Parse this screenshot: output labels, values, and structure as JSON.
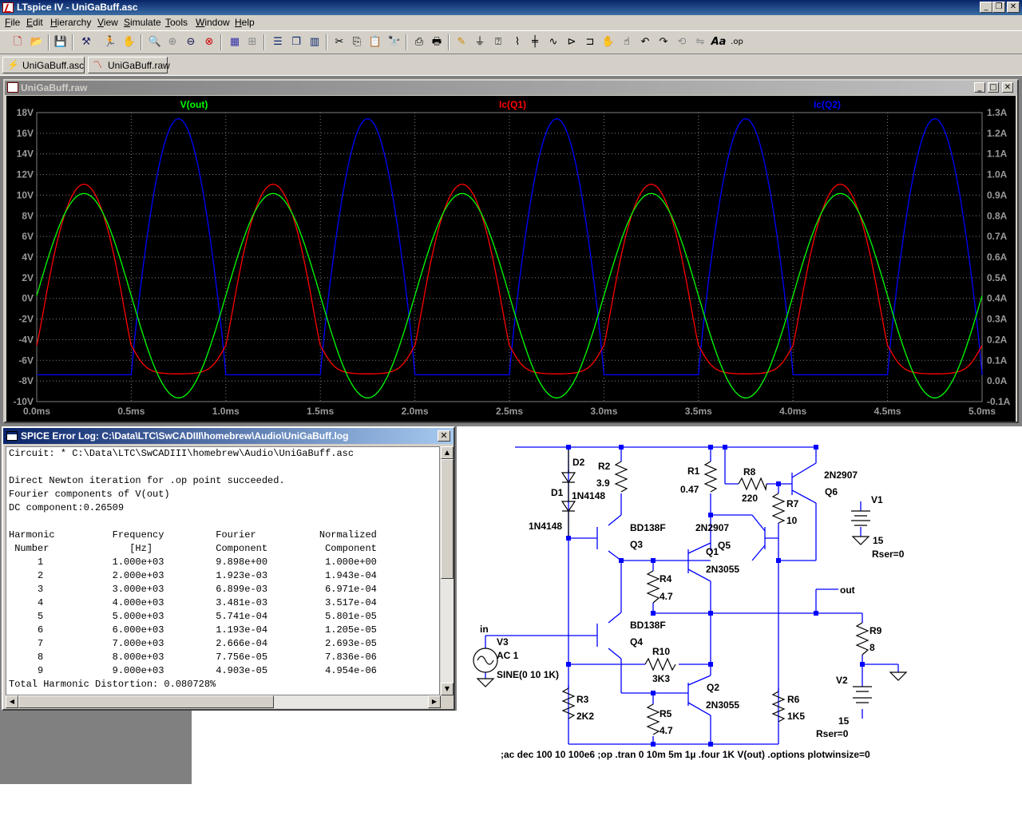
{
  "window": {
    "title": "LTspice IV - UniGaBuff.asc",
    "controls": {
      "minimize": "_",
      "restore": "❐",
      "close": "✕"
    }
  },
  "menu": [
    "File",
    "Edit",
    "Hierarchy",
    "View",
    "Simulate",
    "Tools",
    "Window",
    "Help"
  ],
  "toolbar_icons": [
    "new-schematic-icon",
    "open-icon",
    "save-icon",
    "control-panel-icon",
    "run-icon",
    "halt-icon",
    "zoom-in-icon",
    "zoom-pan-icon",
    "zoom-out-icon",
    "zoom-fit-icon",
    "autorange-icon",
    "grid-icon",
    "tile-horizontal-icon",
    "cascade-icon",
    "tile-vertical-icon",
    "cut-icon",
    "copy-icon",
    "paste-icon",
    "find-icon",
    "print-setup-icon",
    "print-icon",
    "wire-icon",
    "ground-icon",
    "label-net-icon",
    "resistor-icon",
    "capacitor-icon",
    "inductor-icon",
    "diode-icon",
    "component-icon",
    "move-icon",
    "drag-icon",
    "undo-icon",
    "redo-icon",
    "rotate-icon",
    "mirror-icon",
    "text-icon",
    "spice-directive-icon"
  ],
  "tabs": [
    {
      "label": "UniGaBuff.asc",
      "icon": "schematic-icon"
    },
    {
      "label": "UniGaBuff.raw",
      "icon": "waveform-icon"
    }
  ],
  "waveform_window": {
    "title": "UniGaBuff.raw"
  },
  "chart_data": {
    "type": "line",
    "x": {
      "label": "",
      "unit": "ms",
      "range": [
        0,
        5.0
      ],
      "ticks": [
        "0.0ms",
        "0.5ms",
        "1.0ms",
        "1.5ms",
        "2.0ms",
        "2.5ms",
        "3.0ms",
        "3.5ms",
        "4.0ms",
        "4.5ms",
        "5.0ms"
      ]
    },
    "y_left": {
      "range": [
        -10,
        18
      ],
      "ticks": [
        "18V",
        "16V",
        "14V",
        "12V",
        "10V",
        "8V",
        "6V",
        "4V",
        "2V",
        "0V",
        "-2V",
        "-4V",
        "-6V",
        "-8V",
        "-10V"
      ]
    },
    "y_right": {
      "range": [
        -0.1,
        1.3
      ],
      "ticks": [
        "1.3A",
        "1.2A",
        "1.1A",
        "1.0A",
        "0.9A",
        "0.8A",
        "0.7A",
        "0.6A",
        "0.5A",
        "0.4A",
        "0.3A",
        "0.2A",
        "0.1A",
        "0.0A",
        "-0.1A"
      ]
    },
    "grid": true,
    "background": "#000000",
    "series": [
      {
        "name": "V(out)",
        "color": "#00ff00",
        "axis": "left",
        "frequency_hz": 1000,
        "amplitude": 9.9,
        "offset": 0.26,
        "phase": "sine"
      },
      {
        "name": "Ic(Q1)",
        "color": "#ff0000",
        "axis": "right",
        "frequency_hz": 1000,
        "peak": 0.96,
        "minimum": 0.03,
        "shape": "class-AB half-wave"
      },
      {
        "name": "Ic(Q2)",
        "color": "#0000ff",
        "axis": "right",
        "frequency_hz": 1000,
        "peak": 1.27,
        "minimum": 0.03,
        "shape": "inverted half-wave"
      }
    ]
  },
  "log_window": {
    "title": "SPICE Error Log: C:\\Data\\LTC\\SwCADIII\\homebrew\\Audio\\UniGaBuff.log",
    "close": "✕",
    "lines": [
      "Circuit: * C:\\Data\\LTC\\SwCADIII\\homebrew\\Audio\\UniGaBuff.asc",
      "",
      "Direct Newton iteration for .op point succeeded.",
      "Fourier components of V(out)",
      "DC component:0.26509",
      "",
      "Harmonic          Frequency         Fourier           Normalized",
      " Number              [Hz]           Component          Component",
      "     1            1.000e+03         9.898e+00          1.000e+00",
      "     2            2.000e+03         1.923e-03          1.943e-04",
      "     3            3.000e+03         6.899e-03          6.971e-04",
      "     4            4.000e+03         3.481e-03          3.517e-04",
      "     5            5.000e+03         5.741e-04          5.801e-05",
      "     6            6.000e+03         1.193e-04          1.205e-05",
      "     7            7.000e+03         2.666e-04          2.693e-05",
      "     8            8.000e+03         7.756e-05          7.836e-06",
      "     9            9.000e+03         4.903e-05          4.954e-06",
      "Total Harmonic Distortion: 0.080728%"
    ]
  },
  "schematic": {
    "labels": {
      "d2": "D2",
      "d1": "D1",
      "d1_model": "1N4148",
      "d2_model": "1N4148",
      "r2": "R2",
      "r2_val": "3.9",
      "r1": "R1",
      "r1_val": "0.47",
      "r8": "R8",
      "r8_val": "220",
      "q6_model": "2N2907",
      "q6": "Q6",
      "r7": "R7",
      "r7_val": "10",
      "v1": "V1",
      "v1_val": "15",
      "v1_rser": "Rser=0",
      "q3_model": "BD138F",
      "q3": "Q3",
      "q5_model": "2N2907",
      "q5": "Q5",
      "q1": "Q1",
      "q1_model": "2N3055",
      "r4": "R4",
      "r4_val": "4.7",
      "out": "out",
      "in": "in",
      "v3": "V3",
      "v3_ac": "AC 1",
      "v3_sine": "SINE(0 10 1K)",
      "q4_model": "BD138F",
      "q4": "Q4",
      "r10": "R10",
      "r10_val": "3K3",
      "r9": "R9",
      "r9_val": "8",
      "v2": "V2",
      "v2_val": "15",
      "v2_rser": "Rser=0",
      "q2": "Q2",
      "q2_model": "2N3055",
      "r3": "R3",
      "r3_val": "2K2",
      "r5": "R5",
      "r5_val": "4.7",
      "r6": "R6",
      "r6_val": "1K5"
    },
    "directives": ";ac dec 100 10 100e6 ;op  .tran 0 10m 5m 1µ .four 1K V(out)  .options plotwinsize=0"
  }
}
